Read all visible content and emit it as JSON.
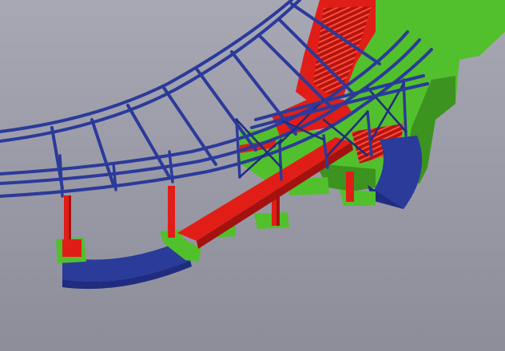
{
  "colors": {
    "background_top": "#a7a8b4",
    "background_bottom": "#8c8d99",
    "steel_frame": "#2b3a9a",
    "steel_frame_dark": "#1f2c7f",
    "concrete_core": "#52c02c",
    "concrete_core_dark": "#3c9320",
    "red_beams": "#e01e17",
    "red_beams_dark": "#a4120f",
    "base_curb": "#2a3b9a"
  }
}
